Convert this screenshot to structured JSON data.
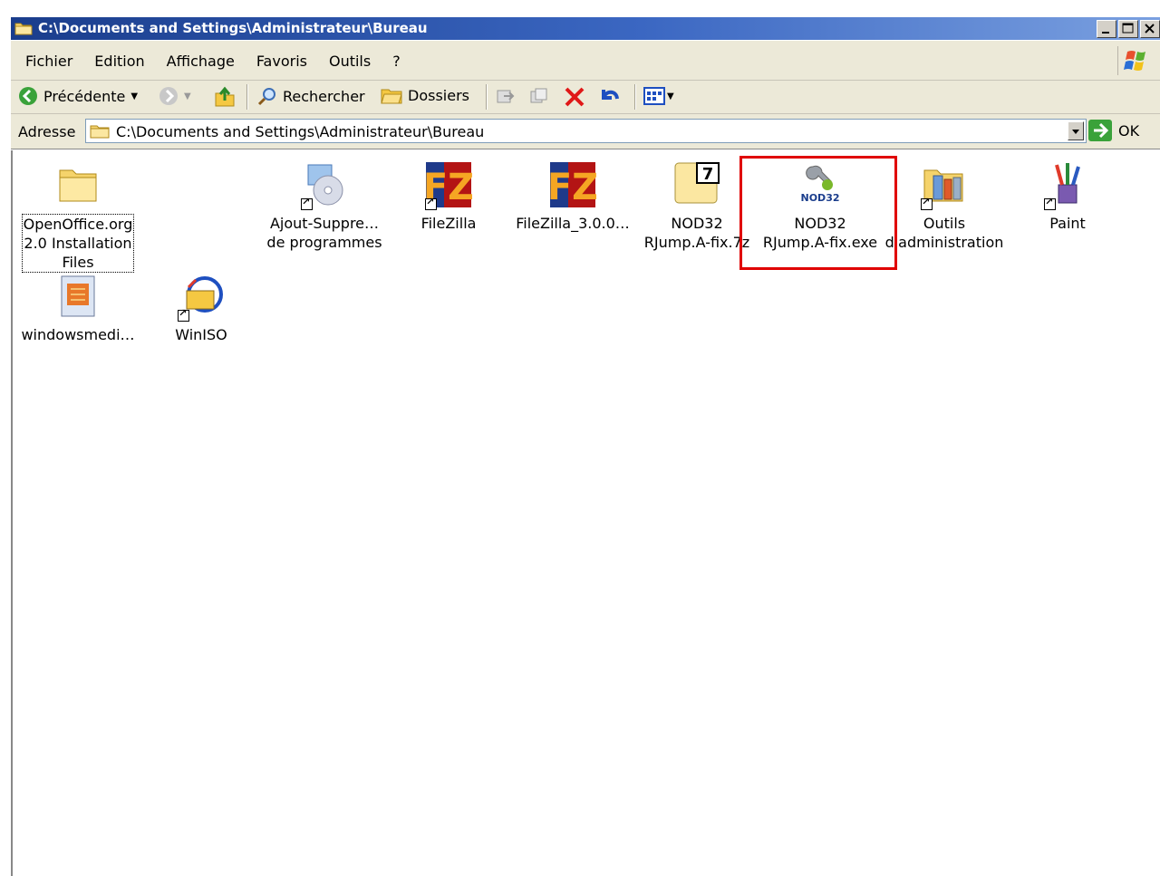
{
  "window": {
    "title": "C:\\Documents and Settings\\Administrateur\\Bureau"
  },
  "menu": [
    "Fichier",
    "Edition",
    "Affichage",
    "Favoris",
    "Outils",
    "?"
  ],
  "toolbar": {
    "back_label": "Précédente",
    "search_label": "Rechercher",
    "folders_label": "Dossiers"
  },
  "address": {
    "label": "Adresse",
    "value": "C:\\Documents and Settings\\Administrateur\\Bureau",
    "go_label": "OK"
  },
  "files": [
    {
      "name": "OpenOffice.org\n2.0 Installation\nFiles",
      "icon": "folder-icon"
    },
    {
      "name": "Ajout-Suppre…\nde programmes",
      "icon": "add-remove-programs-icon"
    },
    {
      "name": "FileZilla",
      "icon": "filezilla-icon"
    },
    {
      "name": "FileZilla_3.0.0…",
      "icon": "filezilla-icon"
    },
    {
      "name": "NOD32\nRJump.A-fix.7z",
      "icon": "7z-archive-icon"
    },
    {
      "name": "NOD32\nRJump.A-fix.exe",
      "icon": "nod32-icon"
    },
    {
      "name": "Outils\nd'administration",
      "icon": "admin-tools-icon"
    },
    {
      "name": "Paint",
      "icon": "paint-icon"
    },
    {
      "name": "windowsmedi…",
      "icon": "media-file-icon"
    },
    {
      "name": "WinISO",
      "icon": "winiso-icon"
    }
  ],
  "colors": {
    "titlebar": "#3b67c2",
    "highlight": "#e00000"
  }
}
